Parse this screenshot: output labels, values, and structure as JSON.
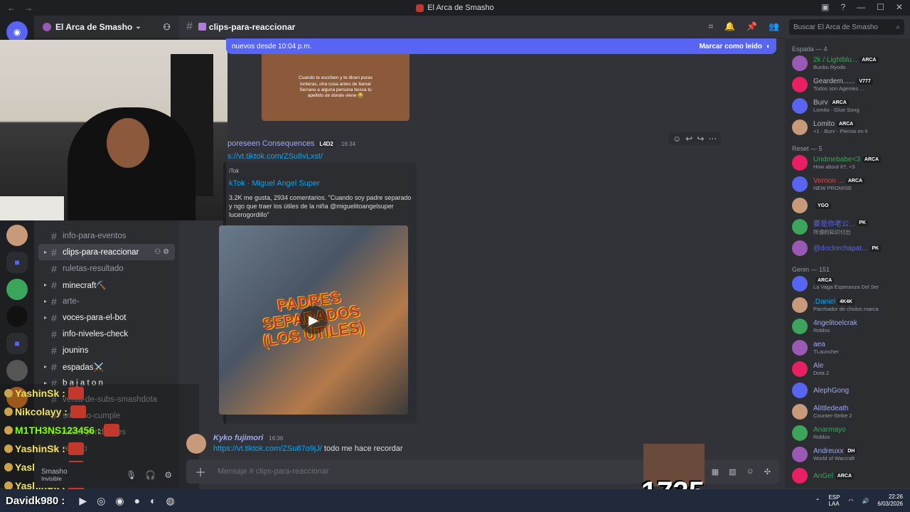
{
  "window": {
    "title": "El Arca de Smasho",
    "nav_back": "←",
    "nav_forward": "→"
  },
  "server": {
    "name": "El Arca de Smasho"
  },
  "channels": [
    {
      "name": "info-para-eventos",
      "active": false,
      "bright": false,
      "arrow": false
    },
    {
      "name": "clips-para-reaccionar",
      "active": true,
      "bright": true,
      "arrow": true
    },
    {
      "name": "ruletas-resultado",
      "active": false,
      "bright": false,
      "arrow": false
    },
    {
      "name": "minecraft⛏️",
      "active": false,
      "bright": true,
      "arrow": true
    },
    {
      "name": "arte-",
      "active": false,
      "bright": false,
      "arrow": true
    },
    {
      "name": "voces-para-el-bot",
      "active": false,
      "bright": true,
      "arrow": true
    },
    {
      "name": "info-niveles-check",
      "active": false,
      "bright": true,
      "arrow": false
    },
    {
      "name": "jounins",
      "active": false,
      "bright": true,
      "arrow": false
    },
    {
      "name": "espadas⚔️",
      "active": false,
      "bright": true,
      "arrow": true
    },
    {
      "name": "b a j a t o n",
      "active": false,
      "bright": true,
      "arrow": true
    },
    {
      "name": "venta-de-subs-smashdota",
      "active": false,
      "bright": false,
      "arrow": false
    },
    {
      "name": "smasho-cumple",
      "active": false,
      "bright": false,
      "arrow": false
    },
    {
      "name": "ruleta-pendientes",
      "active": false,
      "bright": false,
      "arrow": false
    },
    {
      "name": "relleno",
      "active": false,
      "bright": false,
      "arrow": false
    }
  ],
  "twitch_chat": [
    {
      "user": "YashinSk :",
      "color": "#f1e05a"
    },
    {
      "user": "Nikcolayy :",
      "color": "#f1e05a"
    },
    {
      "user": "M1TH3NS123456 :",
      "color": "#7fff00"
    },
    {
      "user": "YashinSk :",
      "color": "#f1e05a"
    },
    {
      "user": "YashinSk :",
      "color": "#f1e05a"
    },
    {
      "user": "YashinSk :",
      "color": "#f1e05a"
    }
  ],
  "user_panel": {
    "name": "Smasho",
    "status": "Invisible"
  },
  "channel_header": {
    "name": "clips-para-reaccionar"
  },
  "search": {
    "placeholder": "Buscar El Arca de Smasho"
  },
  "new_messages_bar": {
    "text": "nuevos desde 10:04 p.m.",
    "mark_read": "Marcar como leído"
  },
  "messages": {
    "thumb_caption": "Cuando te escriben y te dicen puras tonteras, otra cosa antes de llamar Serrano a alguna persona busca tu apellido de donde viene 😂",
    "first": {
      "author": "poreseen Consequences",
      "tag": "L4D2",
      "time": "16:34",
      "link": "s://vt.tiktok.com/ZSu8vLxst/",
      "embed_provider": "iTok",
      "embed_title": "kTok · Miguel Angel Super",
      "embed_desc": "3.2K me gusta, 2934 comentarios. \"Cuando soy padre separado y ngo que traer los útiles de la niña @miguelitoangelsuper lucerogordillo\"",
      "video_overlay": "PADRES SEPARADOS (LOS ÚTILES)"
    },
    "second": {
      "author": "Kyko fujimori",
      "time": "16:36",
      "link": "https://vt.tiktok.com/ZSu87o9jJ/",
      "text": " todo me hace recordar"
    }
  },
  "composer": {
    "placeholder": "Mensaje # clips-para-reaccionar"
  },
  "members": {
    "groups": [
      {
        "title": "Espada — 4",
        "items": [
          {
            "name": "2k / Lightblu...",
            "tag": "ARCA",
            "activity": "Bunbu Ryodo",
            "color": "#3ba55c"
          },
          {
            "name": "Geardem......",
            "tag": "V777",
            "activity": "Todos son Agentes ...",
            "color": "#b5bac1"
          },
          {
            "name": "Burv",
            "tag": "ARCA",
            "activity": "Lomito · Glue Song",
            "color": "#b5bac1"
          },
          {
            "name": "Lomito",
            "tag": "ARCA",
            "activity": "+1 · Burv - Pienso en ti",
            "color": "#b5bac1"
          }
        ]
      },
      {
        "title": "Reset — 5",
        "items": [
          {
            "name": "Undmebabe<3",
            "tag": "ARCA",
            "activity": "How about it?, <3",
            "color": "#3ba55c"
          },
          {
            "name": "Vernon ...",
            "tag": "ARCA",
            "activity": "NEW PROMISE",
            "color": "#ed4245"
          },
          {
            "name": "",
            "tag": "YGO",
            "activity": "",
            "color": "#ed4245"
          },
          {
            "name": "要是你老公...",
            "tag": "PK",
            "activity": "所谓的知识付出",
            "color": "#5865f2"
          },
          {
            "name": "@doctorchapat...",
            "tag": "PK",
            "activity": "",
            "color": "#5865f2"
          }
        ]
      },
      {
        "title": "Genin — 151",
        "items": [
          {
            "name": "",
            "tag": "ARCA",
            "activity": "La Vaga Esperanza Del Ser",
            "color": "#b5bac1"
          },
          {
            "name": ".Daniel",
            "tag": "4K4K",
            "activity": "Parchador de cholos marca",
            "color": "#00a8fc"
          },
          {
            "name": "4ngelitoelcrak",
            "tag": "",
            "activity": "Roblox",
            "color": "#9ea8f5"
          },
          {
            "name": "aea",
            "tag": "",
            "activity": "TLauncher",
            "color": "#9ea8f5"
          },
          {
            "name": "Ale",
            "tag": "",
            "activity": "Dota 2",
            "color": "#9ea8f5"
          },
          {
            "name": "AlephGong",
            "tag": "",
            "activity": "",
            "color": "#9ea8f5"
          },
          {
            "name": "Alittledeath",
            "tag": "",
            "activity": "Counter-Strike 2",
            "color": "#9ea8f5"
          },
          {
            "name": "Anarmayo",
            "tag": "",
            "activity": "Roblox",
            "color": "#3ba55c"
          },
          {
            "name": "Andreuxx",
            "tag": "DH",
            "activity": "World of Warcraft",
            "color": "#9ea8f5"
          },
          {
            "name": "AnGel",
            "tag": "ARCA",
            "activity": "",
            "color": "#3ba55c"
          }
        ]
      }
    ]
  },
  "stream_overlay": {
    "counter": "1735"
  },
  "taskbar": {
    "user": "Davidk980 :",
    "lang": "ESP",
    "lang2": "LAA",
    "time": "22:26",
    "date": "6/03/2026"
  }
}
